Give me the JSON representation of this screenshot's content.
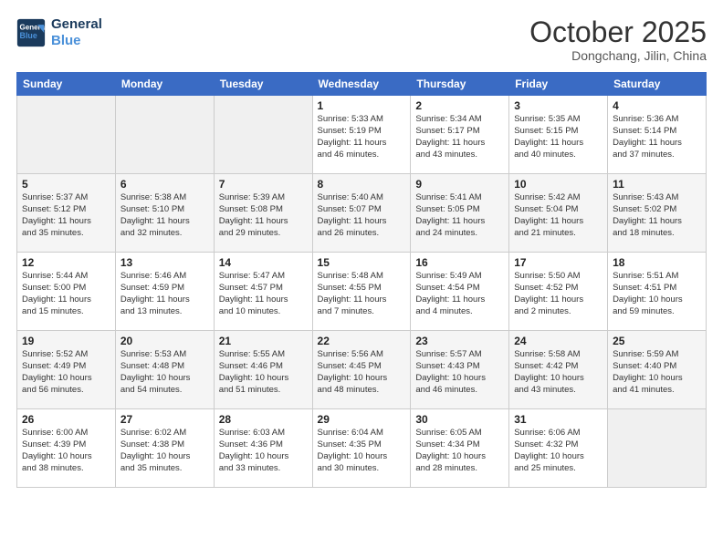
{
  "header": {
    "logo_line1": "General",
    "logo_line2": "Blue",
    "month": "October 2025",
    "location": "Dongchang, Jilin, China"
  },
  "weekdays": [
    "Sunday",
    "Monday",
    "Tuesday",
    "Wednesday",
    "Thursday",
    "Friday",
    "Saturday"
  ],
  "weeks": [
    [
      {
        "day": "",
        "info": ""
      },
      {
        "day": "",
        "info": ""
      },
      {
        "day": "",
        "info": ""
      },
      {
        "day": "1",
        "info": "Sunrise: 5:33 AM\nSunset: 5:19 PM\nDaylight: 11 hours\nand 46 minutes."
      },
      {
        "day": "2",
        "info": "Sunrise: 5:34 AM\nSunset: 5:17 PM\nDaylight: 11 hours\nand 43 minutes."
      },
      {
        "day": "3",
        "info": "Sunrise: 5:35 AM\nSunset: 5:15 PM\nDaylight: 11 hours\nand 40 minutes."
      },
      {
        "day": "4",
        "info": "Sunrise: 5:36 AM\nSunset: 5:14 PM\nDaylight: 11 hours\nand 37 minutes."
      }
    ],
    [
      {
        "day": "5",
        "info": "Sunrise: 5:37 AM\nSunset: 5:12 PM\nDaylight: 11 hours\nand 35 minutes."
      },
      {
        "day": "6",
        "info": "Sunrise: 5:38 AM\nSunset: 5:10 PM\nDaylight: 11 hours\nand 32 minutes."
      },
      {
        "day": "7",
        "info": "Sunrise: 5:39 AM\nSunset: 5:08 PM\nDaylight: 11 hours\nand 29 minutes."
      },
      {
        "day": "8",
        "info": "Sunrise: 5:40 AM\nSunset: 5:07 PM\nDaylight: 11 hours\nand 26 minutes."
      },
      {
        "day": "9",
        "info": "Sunrise: 5:41 AM\nSunset: 5:05 PM\nDaylight: 11 hours\nand 24 minutes."
      },
      {
        "day": "10",
        "info": "Sunrise: 5:42 AM\nSunset: 5:04 PM\nDaylight: 11 hours\nand 21 minutes."
      },
      {
        "day": "11",
        "info": "Sunrise: 5:43 AM\nSunset: 5:02 PM\nDaylight: 11 hours\nand 18 minutes."
      }
    ],
    [
      {
        "day": "12",
        "info": "Sunrise: 5:44 AM\nSunset: 5:00 PM\nDaylight: 11 hours\nand 15 minutes."
      },
      {
        "day": "13",
        "info": "Sunrise: 5:46 AM\nSunset: 4:59 PM\nDaylight: 11 hours\nand 13 minutes."
      },
      {
        "day": "14",
        "info": "Sunrise: 5:47 AM\nSunset: 4:57 PM\nDaylight: 11 hours\nand 10 minutes."
      },
      {
        "day": "15",
        "info": "Sunrise: 5:48 AM\nSunset: 4:55 PM\nDaylight: 11 hours\nand 7 minutes."
      },
      {
        "day": "16",
        "info": "Sunrise: 5:49 AM\nSunset: 4:54 PM\nDaylight: 11 hours\nand 4 minutes."
      },
      {
        "day": "17",
        "info": "Sunrise: 5:50 AM\nSunset: 4:52 PM\nDaylight: 11 hours\nand 2 minutes."
      },
      {
        "day": "18",
        "info": "Sunrise: 5:51 AM\nSunset: 4:51 PM\nDaylight: 10 hours\nand 59 minutes."
      }
    ],
    [
      {
        "day": "19",
        "info": "Sunrise: 5:52 AM\nSunset: 4:49 PM\nDaylight: 10 hours\nand 56 minutes."
      },
      {
        "day": "20",
        "info": "Sunrise: 5:53 AM\nSunset: 4:48 PM\nDaylight: 10 hours\nand 54 minutes."
      },
      {
        "day": "21",
        "info": "Sunrise: 5:55 AM\nSunset: 4:46 PM\nDaylight: 10 hours\nand 51 minutes."
      },
      {
        "day": "22",
        "info": "Sunrise: 5:56 AM\nSunset: 4:45 PM\nDaylight: 10 hours\nand 48 minutes."
      },
      {
        "day": "23",
        "info": "Sunrise: 5:57 AM\nSunset: 4:43 PM\nDaylight: 10 hours\nand 46 minutes."
      },
      {
        "day": "24",
        "info": "Sunrise: 5:58 AM\nSunset: 4:42 PM\nDaylight: 10 hours\nand 43 minutes."
      },
      {
        "day": "25",
        "info": "Sunrise: 5:59 AM\nSunset: 4:40 PM\nDaylight: 10 hours\nand 41 minutes."
      }
    ],
    [
      {
        "day": "26",
        "info": "Sunrise: 6:00 AM\nSunset: 4:39 PM\nDaylight: 10 hours\nand 38 minutes."
      },
      {
        "day": "27",
        "info": "Sunrise: 6:02 AM\nSunset: 4:38 PM\nDaylight: 10 hours\nand 35 minutes."
      },
      {
        "day": "28",
        "info": "Sunrise: 6:03 AM\nSunset: 4:36 PM\nDaylight: 10 hours\nand 33 minutes."
      },
      {
        "day": "29",
        "info": "Sunrise: 6:04 AM\nSunset: 4:35 PM\nDaylight: 10 hours\nand 30 minutes."
      },
      {
        "day": "30",
        "info": "Sunrise: 6:05 AM\nSunset: 4:34 PM\nDaylight: 10 hours\nand 28 minutes."
      },
      {
        "day": "31",
        "info": "Sunrise: 6:06 AM\nSunset: 4:32 PM\nDaylight: 10 hours\nand 25 minutes."
      },
      {
        "day": "",
        "info": ""
      }
    ]
  ]
}
